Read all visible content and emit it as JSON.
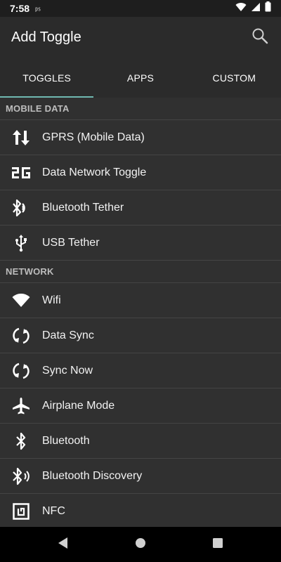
{
  "status_bar": {
    "time": "7:58",
    "small": "㎰"
  },
  "app_bar": {
    "title": "Add Toggle"
  },
  "tabs": [
    {
      "label": "TOGGLES",
      "selected": true
    },
    {
      "label": "APPS",
      "selected": false
    },
    {
      "label": "CUSTOM",
      "selected": false
    }
  ],
  "sections": [
    {
      "header": "MOBILE DATA",
      "items": [
        {
          "label": "GPRS (Mobile Data)",
          "icon": "data-arrows-icon"
        },
        {
          "label": "Data Network Toggle",
          "icon": "2g-icon"
        },
        {
          "label": "Bluetooth Tether",
          "icon": "bluetooth-tether-icon"
        },
        {
          "label": "USB Tether",
          "icon": "usb-icon"
        }
      ]
    },
    {
      "header": "NETWORK",
      "items": [
        {
          "label": "Wifi",
          "icon": "wifi-icon"
        },
        {
          "label": "Data Sync",
          "icon": "sync-icon"
        },
        {
          "label": "Sync Now",
          "icon": "sync-icon"
        },
        {
          "label": "Airplane Mode",
          "icon": "airplane-icon"
        },
        {
          "label": "Bluetooth",
          "icon": "bluetooth-icon"
        },
        {
          "label": "Bluetooth Discovery",
          "icon": "bluetooth-discovery-icon"
        },
        {
          "label": "NFC",
          "icon": "nfc-icon"
        }
      ]
    }
  ],
  "colors": {
    "accent": "#6fb8b0",
    "background": "#303030",
    "app_bar": "#2b2b2b"
  }
}
